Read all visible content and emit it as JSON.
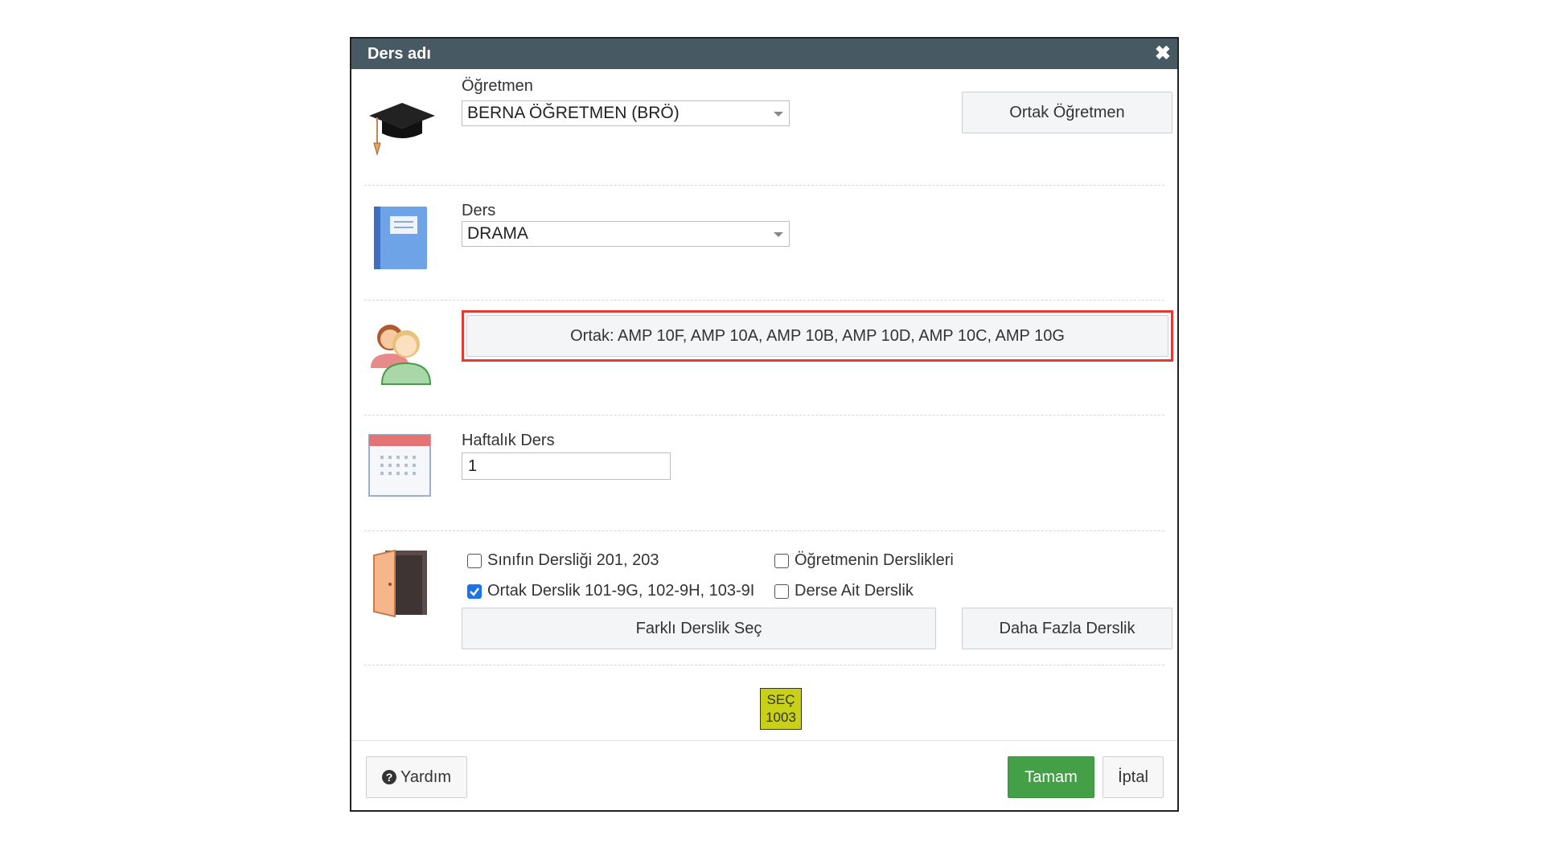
{
  "dialog": {
    "title": "Ders adı",
    "close_label": "✖"
  },
  "teacher": {
    "label": "Öğretmen",
    "selected": "BERNA ÖĞRETMEN (BRÖ)",
    "ortak_button": "Ortak Öğretmen",
    "icon": "graduation-cap-icon"
  },
  "course": {
    "label": "Ders",
    "selected": "DRAMA",
    "icon": "book-icon"
  },
  "classes": {
    "ortak_button": "Ortak: AMP 10F, AMP 10A, AMP 10B, AMP 10D, AMP 10C, AMP 10G",
    "icon": "users-icon",
    "highlight_color": "#e53935"
  },
  "weekly": {
    "label": "Haftalık Ders",
    "value": "1",
    "icon": "calendar-icon"
  },
  "rooms": {
    "icon": "door-icon",
    "checkboxes": [
      {
        "label": "Sınıfın Dersliği 201, 203",
        "checked": false
      },
      {
        "label": "Öğretmenin Derslikleri",
        "checked": false
      },
      {
        "label": "Ortak Derslik 101-9G, 102-9H, 103-9I",
        "checked": true
      },
      {
        "label": "Derse Ait Derslik",
        "checked": false
      }
    ],
    "farkli_button": "Farklı Derslik Seç",
    "daha_button": "Daha Fazla Derslik"
  },
  "selection": {
    "line1": "SEÇ",
    "line2": "1003",
    "color": "#c8d118"
  },
  "footer": {
    "help_label": "Yardım",
    "ok_label": "Tamam",
    "cancel_label": "İptal",
    "ok_color": "#43a047"
  }
}
